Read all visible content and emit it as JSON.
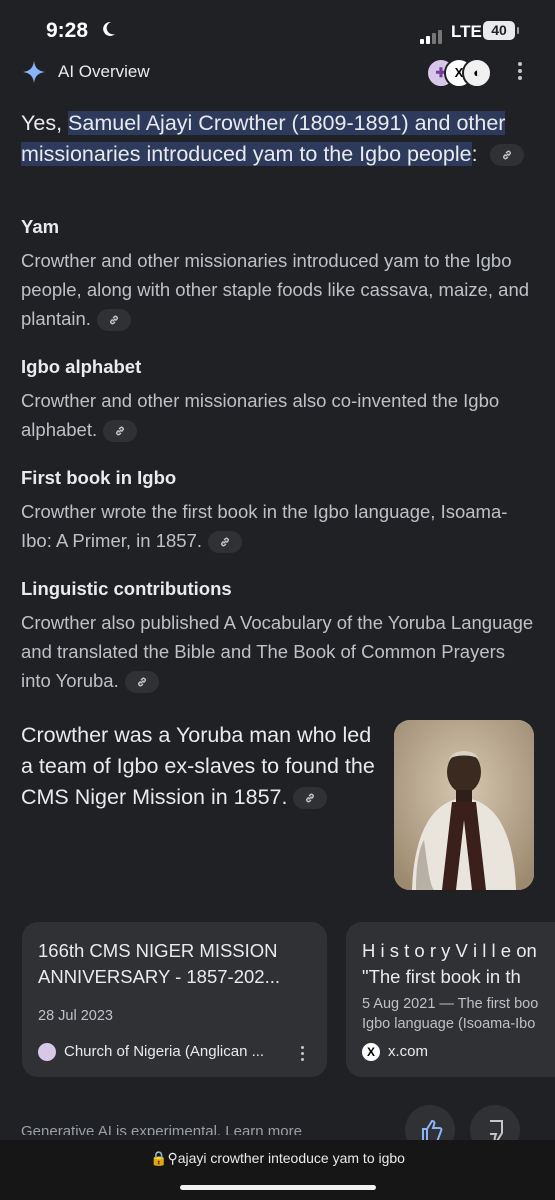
{
  "status_bar": {
    "time": "9:28",
    "network": "LTE",
    "battery": "40"
  },
  "overview": {
    "title": "AI Overview"
  },
  "intro": {
    "prefix": "Yes, ",
    "highlight": "Samuel Ajayi Crowther (1809-1891) and other missionaries introduced yam to the Igbo people",
    "suffix": ":"
  },
  "sections": [
    {
      "heading": "Yam",
      "body": "Crowther and other missionaries introduced yam to the Igbo people, along with other staple foods like cassava, maize, and plantain."
    },
    {
      "heading": "Igbo alphabet",
      "body": "Crowther and other missionaries also co-invented the Igbo alphabet."
    },
    {
      "heading": "First book in Igbo",
      "body": "Crowther wrote the first book in the Igbo language, Isoama-Ibo: A Primer, in 1857."
    },
    {
      "heading": "Linguistic contributions",
      "body": "Crowther also published A Vocabulary of the Yoruba Language and translated the Bible and The Book of Common Prayers into Yoruba."
    }
  ],
  "crowther_note": "Crowther was a Yoruba man who led a team of Igbo ex-slaves to found the CMS Niger Mission in 1857.",
  "cards": [
    {
      "title_line1": "166th CMS NIGER MISSION",
      "title_line2": "ANNIVERSARY - 1857-202...",
      "date": "28 Jul 2023",
      "date2": "",
      "source": "Church of Nigeria (Anglican ..."
    },
    {
      "title_line1": "H i s t o r y V i l l e on",
      "title_line2": "\"The first book in th",
      "date": "5 Aug 2021 — The first boo",
      "date2": "Igbo language (Isoama-Ibo",
      "source": "x.com"
    }
  ],
  "footer": {
    "note": "Generative AI is experimental. Learn more"
  },
  "browser": {
    "url": "ajayi crowther inteoduce yam to igbo"
  },
  "colors": {
    "background": "#202124",
    "highlight": "#2d3a5c",
    "card": "#303134",
    "accent": "#8ab4f8"
  },
  "icons": [
    "gemini-spark-icon",
    "link-icon",
    "more-vert-icon",
    "thumbs-up-icon",
    "thumbs-down-icon",
    "lock-icon",
    "search-icon"
  ]
}
